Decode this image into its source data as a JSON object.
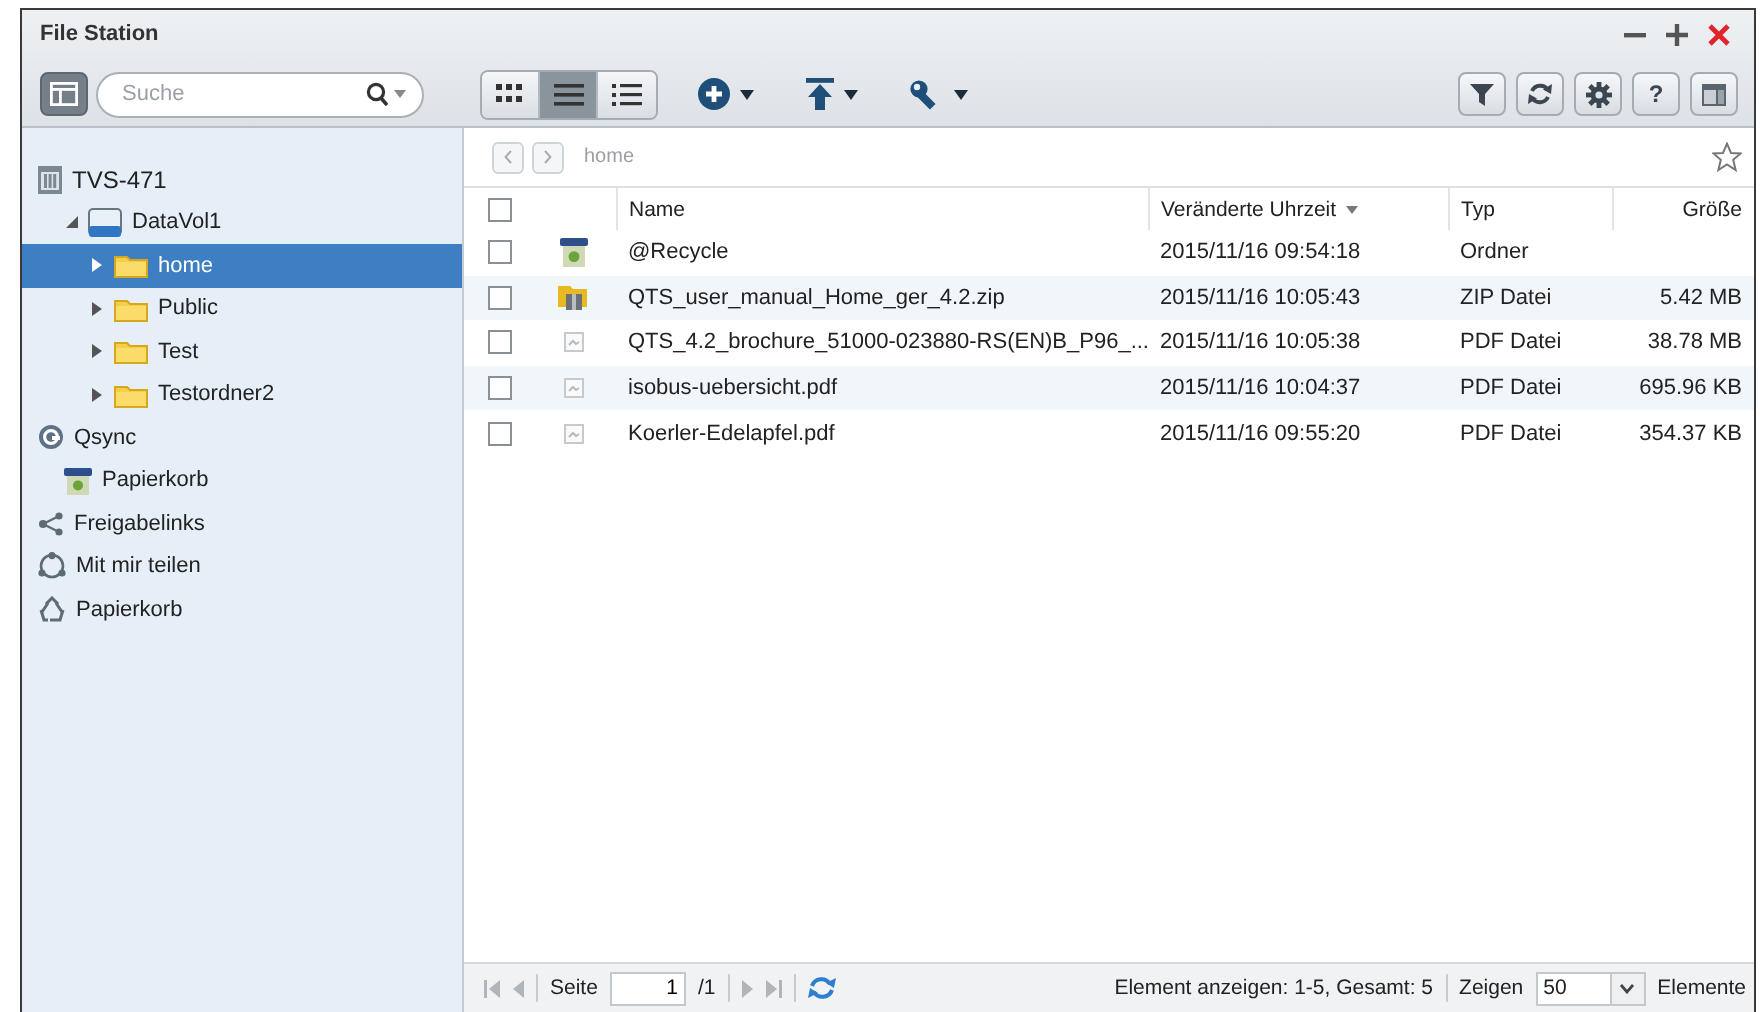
{
  "window": {
    "title": "File Station"
  },
  "toolbar": {
    "search": {
      "placeholder": "Suche"
    },
    "views": [
      {
        "kind": "grid",
        "selected": false
      },
      {
        "kind": "list",
        "selected": true
      },
      {
        "kind": "details",
        "selected": false
      }
    ],
    "actions": [
      {
        "kind": "create"
      },
      {
        "kind": "upload"
      },
      {
        "kind": "tools"
      }
    ],
    "right_buttons": [
      {
        "kind": "filter"
      },
      {
        "kind": "refresh"
      },
      {
        "kind": "settings"
      },
      {
        "kind": "help",
        "label": "?"
      },
      {
        "kind": "panel"
      }
    ]
  },
  "sidebar": {
    "tree": [
      {
        "label": "TVS-471",
        "kind": "nas",
        "selected": false,
        "children": [
          {
            "label": "DataVol1",
            "kind": "volume",
            "selected": false,
            "expanded": true,
            "children": [
              {
                "label": "home",
                "kind": "folder",
                "selected": true,
                "expanded": false
              },
              {
                "label": "Public",
                "kind": "folder",
                "selected": false,
                "expanded": false
              },
              {
                "label": "Test",
                "kind": "folder",
                "selected": false,
                "expanded": false
              },
              {
                "label": "Testordner2",
                "kind": "folder",
                "selected": false,
                "expanded": false
              }
            ]
          }
        ]
      },
      {
        "label": "Qsync",
        "kind": "qsync",
        "selected": false,
        "children": [
          {
            "label": "Papierkorb",
            "kind": "trash",
            "selected": false
          }
        ]
      },
      {
        "label": "Freigabelinks",
        "kind": "share",
        "selected": false
      },
      {
        "label": "Mit mir teilen",
        "kind": "shared",
        "selected": false
      },
      {
        "label": "Papierkorb",
        "kind": "recycle",
        "selected": false
      }
    ]
  },
  "path": {
    "breadcrumb": "home",
    "favorite": false
  },
  "table": {
    "select_all_checked": false,
    "columns": [
      {
        "label": "Name",
        "sorted": false
      },
      {
        "label": "Veränderte Uhrzeit",
        "sorted": true
      },
      {
        "label": "Typ",
        "sorted": false
      },
      {
        "label": "Größe",
        "sorted": false
      }
    ],
    "rows": [
      {
        "kind": "recycle",
        "checked": false,
        "name": "@Recycle",
        "modified": "2015/11/16 09:54:18",
        "type": "Ordner",
        "size": ""
      },
      {
        "kind": "zip",
        "checked": false,
        "name": "QTS_user_manual_Home_ger_4.2.zip",
        "modified": "2015/11/16 10:05:43",
        "type": "ZIP Datei",
        "size": "5.42 MB"
      },
      {
        "kind": "pdf",
        "checked": false,
        "name": "QTS_4.2_brochure_51000-023880-RS(EN)B_P96_...",
        "modified": "2015/11/16 10:05:38",
        "type": "PDF Datei",
        "size": "38.78 MB"
      },
      {
        "kind": "pdf",
        "checked": false,
        "name": "isobus-uebersicht.pdf",
        "modified": "2015/11/16 10:04:37",
        "type": "PDF Datei",
        "size": "695.96 KB"
      },
      {
        "kind": "pdf",
        "checked": false,
        "name": "Koerler-Edelapfel.pdf",
        "modified": "2015/11/16 09:55:20",
        "type": "PDF Datei",
        "size": "354.37 KB"
      }
    ]
  },
  "pager": {
    "page_label": "Seite",
    "page": "1",
    "page_total": "/1",
    "status": "Element anzeigen: 1-5, Gesamt: 5",
    "show_label": "Zeigen",
    "per_page": "50",
    "unit": "Elemente"
  }
}
